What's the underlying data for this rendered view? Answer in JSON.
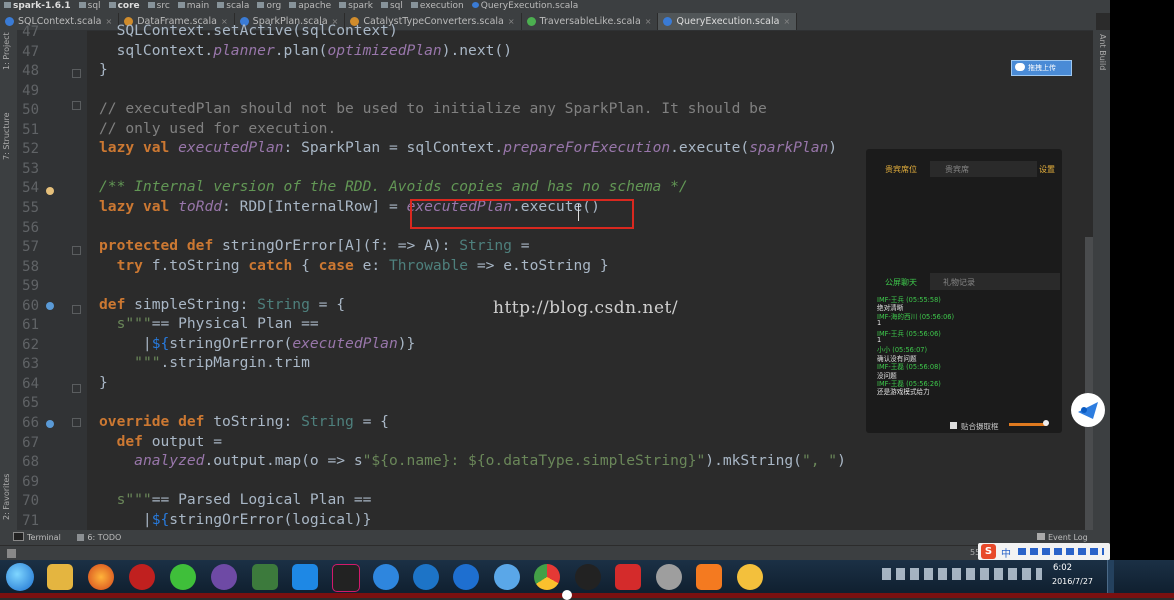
{
  "breadcrumb": [
    "spark-1.6.1",
    "sql",
    "core",
    "src",
    "main",
    "scala",
    "org",
    "apache",
    "spark",
    "sql",
    "execution",
    "QueryExecution.scala"
  ],
  "tabs": [
    {
      "label": "SQLContext.scala",
      "icon": "scala-class-icon",
      "color": "#3a7bd5",
      "active": false
    },
    {
      "label": "DataFrame.scala",
      "icon": "scala-object-icon",
      "color": "#d08c2c",
      "active": false
    },
    {
      "label": "SparkPlan.scala",
      "icon": "scala-class-icon",
      "color": "#3a7bd5",
      "active": false
    },
    {
      "label": "CatalystTypeConverters.scala",
      "icon": "scala-object-icon",
      "color": "#d08c2c",
      "active": false
    },
    {
      "label": "TraversableLike.scala",
      "icon": "scala-trait-icon",
      "color": "#4caf50",
      "active": false
    },
    {
      "label": "QueryExecution.scala",
      "icon": "scala-class-icon",
      "color": "#3a7bd5",
      "active": true
    }
  ],
  "tab_close": "×",
  "left_tools": [
    "1: Project",
    "7: Structure",
    "2: Favorites"
  ],
  "right_tools": [
    "Ant Build"
  ],
  "code": {
    "lines": [
      {
        "n": "47",
        "text": "  SQLContext.setActive(sqlContext)"
      },
      {
        "n": "47",
        "text": "  sqlContext.planner.plan(optimizedPlan).next()"
      },
      {
        "n": "48",
        "text": "}"
      },
      {
        "n": "49",
        "text": ""
      },
      {
        "n": "50",
        "text": "// executedPlan should not be used to initialize any SparkPlan. It should be"
      },
      {
        "n": "51",
        "text": "// only used for execution."
      },
      {
        "n": "52",
        "text": "lazy val executedPlan: SparkPlan = sqlContext.prepareForExecution.execute(sparkPlan)"
      },
      {
        "n": "53",
        "text": ""
      },
      {
        "n": "54",
        "text": "/** Internal version of the RDD. Avoids copies and has no schema */"
      },
      {
        "n": "55",
        "text": "lazy val toRdd: RDD[InternalRow] = executedPlan.execute()"
      },
      {
        "n": "56",
        "text": ""
      },
      {
        "n": "57",
        "text": "protected def stringOrError[A](f: => A): String ="
      },
      {
        "n": "58",
        "text": "  try f.toString catch { case e: Throwable => e.toString }"
      },
      {
        "n": "59",
        "text": ""
      },
      {
        "n": "60",
        "text": "def simpleString: String = {"
      },
      {
        "n": "61",
        "text": "  s\"\"\"== Physical Plan =="
      },
      {
        "n": "62",
        "text": "     |${stringOrError(executedPlan)}"
      },
      {
        "n": "63",
        "text": "    \"\"\".stripMargin.trim"
      },
      {
        "n": "64",
        "text": "}"
      },
      {
        "n": "65",
        "text": ""
      },
      {
        "n": "66",
        "text": "override def toString: String = {"
      },
      {
        "n": "67",
        "text": "  def output ="
      },
      {
        "n": "68",
        "text": "    analyzed.output.map(o => s\"${o.name}: ${o.dataType.simpleString}\").mkString(\", \")"
      },
      {
        "n": "69",
        "text": ""
      },
      {
        "n": "70",
        "text": "  s\"\"\"== Parsed Logical Plan =="
      },
      {
        "n": "71",
        "text": "     |${stringOrError(logical)}"
      }
    ]
  },
  "watermark": "http://blog.csdn.net/",
  "upload_button": "拖拽上传",
  "chat": {
    "tab_guest": "贵宾席位",
    "tab_guest_list": "贵宾席",
    "settings": "设置",
    "tab_public": "公屏聊天",
    "tab_gifts": "礼物记录",
    "messages": [
      {
        "type": "name",
        "text": "IMF-王兵 (05:55:58)"
      },
      {
        "type": "text",
        "text": "绝对清晰"
      },
      {
        "type": "name",
        "text": "IMF-海的西川 (05:56:06)"
      },
      {
        "type": "text",
        "text": "1"
      },
      {
        "type": "name",
        "text": "IMF-王兵 (05:56:06)"
      },
      {
        "type": "text",
        "text": "1"
      },
      {
        "type": "name",
        "text": "小小 (05:56:07)"
      },
      {
        "type": "text",
        "text": "确认没有问题"
      },
      {
        "type": "name",
        "text": "IMF-王磊 (05:56:08)"
      },
      {
        "type": "text",
        "text": "没问题"
      },
      {
        "type": "name",
        "text": "IMF-王磊 (05:56:26)"
      },
      {
        "type": "text",
        "text": "还是游戏模式给力"
      }
    ],
    "checkbox_label": "贴合摄取框"
  },
  "status": {
    "terminal": "Terminal",
    "todo": "6: TODO",
    "event_log": "Event Log",
    "position": "55"
  },
  "taskbar": {
    "time": "6:02",
    "date": "2016/7/27",
    "ime": "中"
  }
}
